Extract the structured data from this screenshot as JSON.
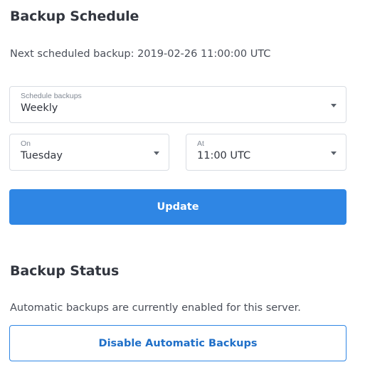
{
  "schedule": {
    "heading": "Backup Schedule",
    "next_backup_text": "Next scheduled backup: 2019-02-26 11:00:00 UTC",
    "frequency": {
      "label": "Schedule backups",
      "value": "Weekly"
    },
    "day": {
      "label": "On",
      "value": "Tuesday"
    },
    "time": {
      "label": "At",
      "value": "11:00 UTC"
    },
    "update_label": "Update"
  },
  "status": {
    "heading": "Backup Status",
    "text": "Automatic backups are currently enabled for this server.",
    "disable_label": "Disable Automatic Backups"
  },
  "colors": {
    "accent": "#2f86e4",
    "heading": "#32363f",
    "border": "#d9dde3"
  },
  "icons": {
    "dropdown": "chevron-down-icon"
  }
}
